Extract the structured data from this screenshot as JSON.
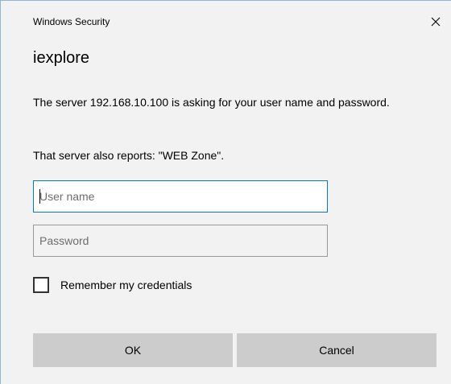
{
  "window": {
    "title": "Windows Security",
    "close_icon": "close-icon"
  },
  "app_name": "iexplore",
  "message": "The server 192.168.10.100 is asking for your user name and password.",
  "report": "That server also reports: \"WEB Zone\".",
  "fields": {
    "username": {
      "value": "",
      "placeholder": "User name",
      "focused": true
    },
    "password": {
      "value": "",
      "placeholder": "Password"
    }
  },
  "remember": {
    "label": "Remember my credentials",
    "checked": false
  },
  "buttons": {
    "ok": "OK",
    "cancel": "Cancel"
  },
  "colors": {
    "background": "#f2f2f2",
    "focus_border": "#0078d7",
    "button": "#cccccc"
  }
}
